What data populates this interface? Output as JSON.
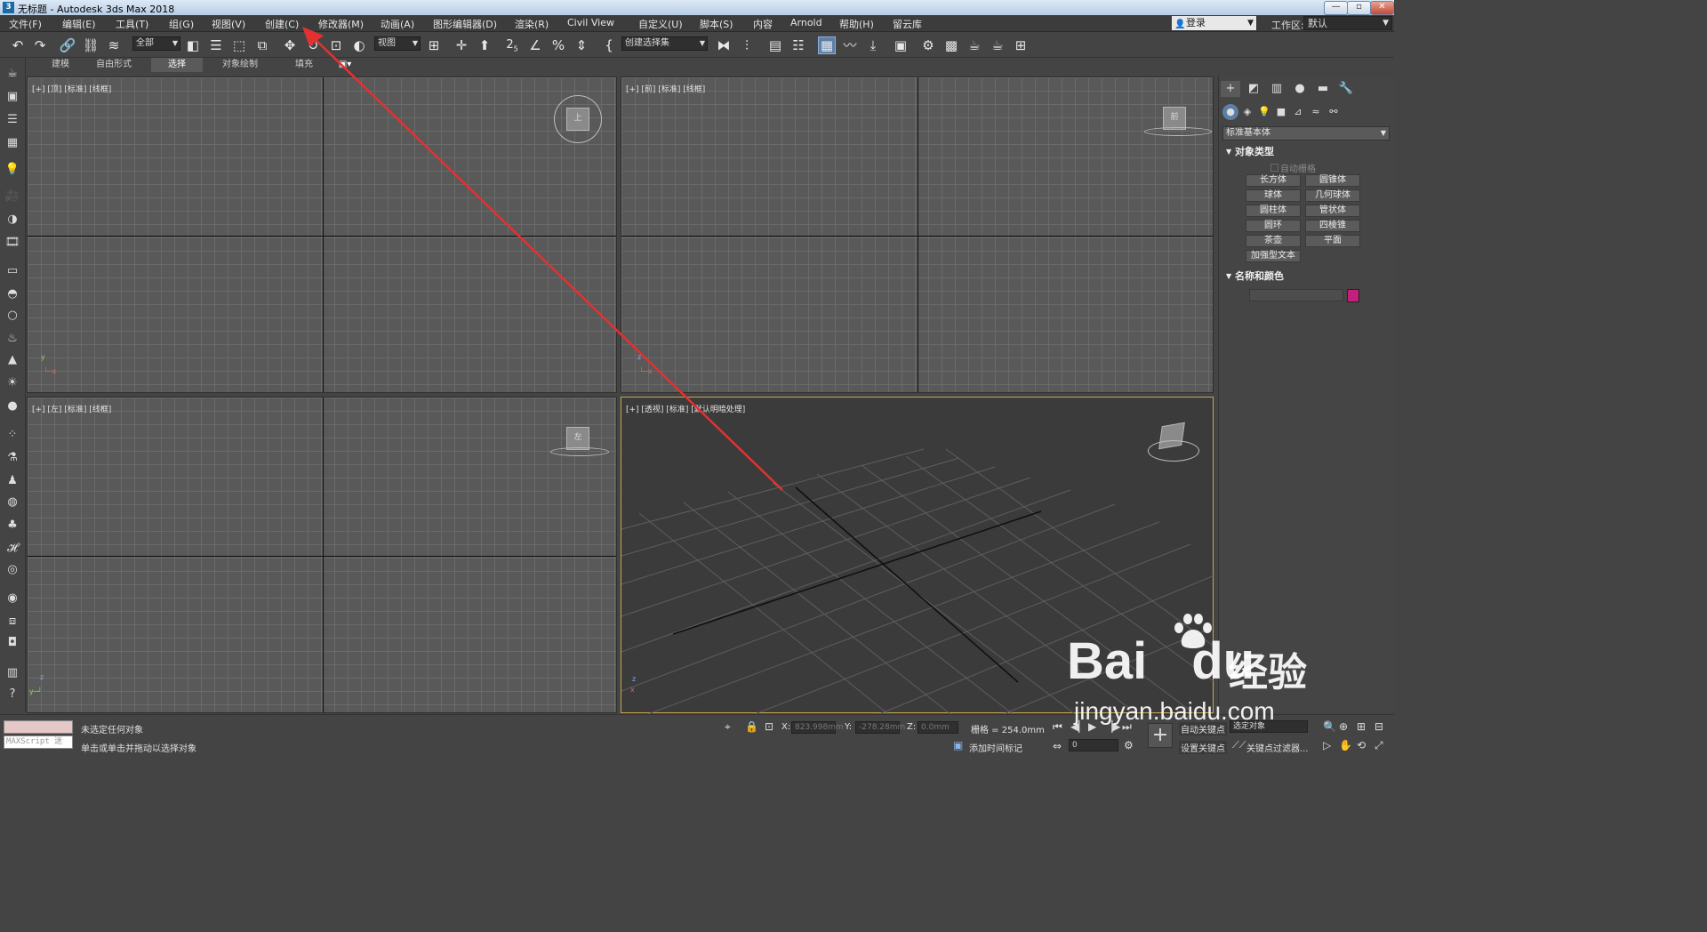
{
  "window": {
    "title": "无标题 - Autodesk 3ds Max 2018",
    "app_icon": "3",
    "minimize": "—",
    "maximize": "▫",
    "close": "✕"
  },
  "menu": {
    "items": [
      "文件(F)",
      "编辑(E)",
      "工具(T)",
      "组(G)",
      "视图(V)",
      "创建(C)",
      "修改器(M)",
      "动画(A)",
      "图形编辑器(D)",
      "渲染(R)",
      "Civil View",
      "自定义(U)",
      "脚本(S)",
      "内容",
      "Arnold",
      "帮助(H)",
      "留云库"
    ],
    "login": "登录",
    "workspace_label": "工作区:",
    "workspace_value": "默认"
  },
  "toolbar": {
    "filter_select": "全部",
    "view_select": "视图",
    "selection_set": "创建选择集",
    "snap_value": "2.5"
  },
  "ribbon": {
    "tabs": [
      "建模",
      "自由形式",
      "选择",
      "对象绘制",
      "填充"
    ],
    "active": "选择"
  },
  "viewports": {
    "top": {
      "label": "[+] [顶] [标准] [线框]",
      "cube_label": "上"
    },
    "front": {
      "label": "[+] [前] [标准] [线框]",
      "cube_label": "前"
    },
    "left": {
      "label": "[+] [左] [标准] [线框]",
      "cube_label": "左"
    },
    "perspective": {
      "label": "[+] [透视] [标准] [默认明暗处理]"
    }
  },
  "command_panel": {
    "category": "标准基本体",
    "object_type_title": "对象类型",
    "autogrid": "自动栅格",
    "object_buttons": [
      "长方体",
      "圆锥体",
      "球体",
      "几何球体",
      "圆柱体",
      "管状体",
      "圆环",
      "四棱锥",
      "茶壶",
      "平面"
    ],
    "extended_text_button": "加强型文本",
    "name_color_title": "名称和颜色",
    "object_color": "#c2207a"
  },
  "status": {
    "maxscript_label": "MAXScript 迷",
    "selection_status": "未选定任何对象",
    "prompt": "单击或单击并拖动以选择对象",
    "x_label": "X:",
    "x_value": "823.998mm",
    "y_label": "Y:",
    "y_value": "-278.28mm",
    "z_label": "Z:",
    "z_value": "0.0mm",
    "grid": "栅格 = 254.0mm",
    "add_time_tag": "添加时间标记",
    "auto_key": "自动关键点",
    "set_key": "设置关键点",
    "selected_objects": "选定对象",
    "key_filters": "关键点过滤器...",
    "frame": "0"
  },
  "annotation": {
    "color": "#e53030"
  },
  "watermark": {
    "brand": "Bai",
    "brand_suffix": "du",
    "product": "经验",
    "url": "jingyan.baidu.com"
  }
}
